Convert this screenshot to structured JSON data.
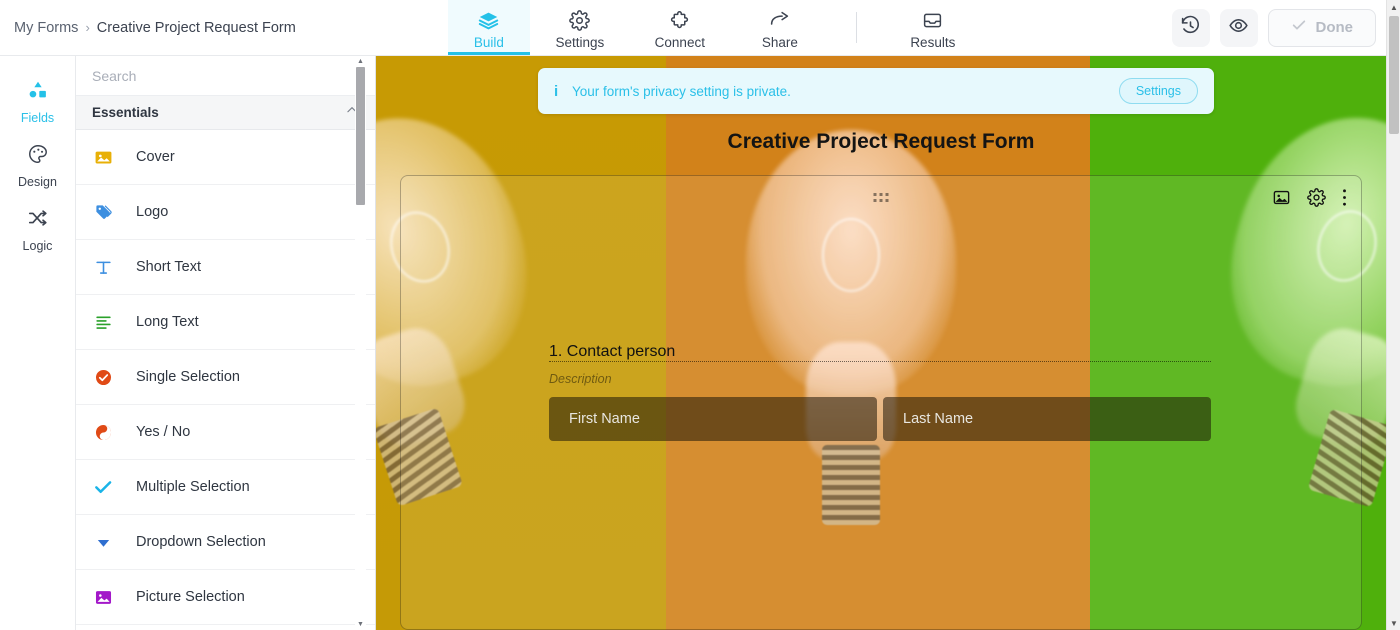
{
  "breadcrumb": {
    "root": "My Forms",
    "separator": "›",
    "current": "Creative Project Request Form"
  },
  "topbar": {
    "tabs": [
      {
        "label": "Build",
        "icon": "layers-icon",
        "active": true
      },
      {
        "label": "Settings",
        "icon": "gear-icon",
        "active": false
      },
      {
        "label": "Connect",
        "icon": "puzzle-icon",
        "active": false
      },
      {
        "label": "Share",
        "icon": "arrow-share-icon",
        "active": false
      },
      {
        "label": "Results",
        "icon": "inbox-icon",
        "active": false
      }
    ],
    "history_icon": "history-clock-icon",
    "preview_icon": "eye-icon",
    "done_label": "Done",
    "done_icon": "check-icon",
    "accent_color": "#24c1e8"
  },
  "rail": {
    "items": [
      {
        "label": "Fields",
        "icon": "shapes-icon",
        "active": true
      },
      {
        "label": "Design",
        "icon": "palette-icon",
        "active": false
      },
      {
        "label": "Logic",
        "icon": "shuffle-icon",
        "active": false
      }
    ]
  },
  "panel": {
    "search_placeholder": "Search",
    "search_value": "",
    "group_label": "Essentials",
    "group_collapse_icon": "chevron-up-icon",
    "fields": [
      {
        "label": "Cover",
        "icon": "image-icon",
        "color": "#e8b007"
      },
      {
        "label": "Logo",
        "icon": "tag-icon",
        "color": "#3d8fe0"
      },
      {
        "label": "Short Text",
        "icon": "text-t-icon",
        "color": "#3d8fe0"
      },
      {
        "label": "Long Text",
        "icon": "text-lines-icon",
        "color": "#2aa12a"
      },
      {
        "label": "Single Selection",
        "icon": "radio-check-icon",
        "color": "#e04a16"
      },
      {
        "label": "Yes / No",
        "icon": "yin-yang-icon",
        "color": "#e04a16"
      },
      {
        "label": "Multiple Selection",
        "icon": "checkmark-icon",
        "color": "#1ab4e8"
      },
      {
        "label": "Dropdown Selection",
        "icon": "triangle-down-icon",
        "color": "#2f6fd0"
      },
      {
        "label": "Picture Selection",
        "icon": "picture-icon",
        "color": "#a318c9"
      }
    ]
  },
  "canvas": {
    "banner": {
      "icon": "info-icon",
      "text": "Your form's privacy setting is private.",
      "button_label": "Settings",
      "color": "#2bc0e8"
    },
    "form_title": "Creative Project Request Form",
    "card": {
      "drag_handle_icon": "drag-dots-icon",
      "tools": [
        {
          "icon": "image-icon",
          "name": "card-image-button"
        },
        {
          "icon": "gear-icon",
          "name": "card-settings-button"
        },
        {
          "icon": "kebab-menu-icon",
          "name": "card-more-button"
        }
      ],
      "question_number": "1.",
      "question_title": "Contact person",
      "description_placeholder": "Description",
      "inputs": [
        {
          "placeholder": "First Name",
          "value": ""
        },
        {
          "placeholder": "Last Name",
          "value": ""
        }
      ]
    },
    "background_colors": {
      "left": "#c79a04",
      "center": "#d2821a",
      "right": "#4fb00c"
    }
  }
}
